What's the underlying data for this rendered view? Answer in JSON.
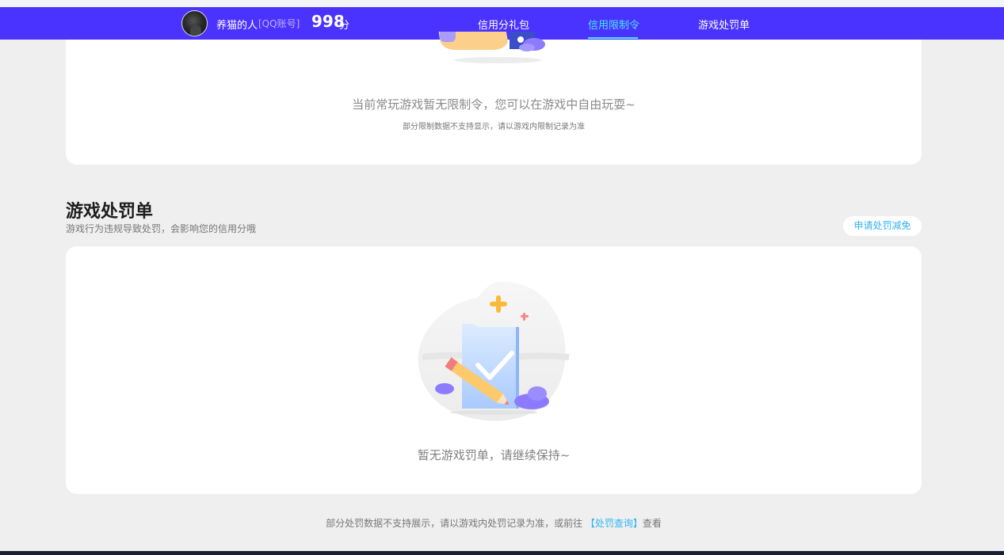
{
  "header": {
    "username": "养猫的人",
    "account_type": "[QQ账号]",
    "score": "998",
    "score_unit": "分",
    "nav": [
      {
        "label": "信用分礼包",
        "active": false
      },
      {
        "label": "信用限制令",
        "active": true
      },
      {
        "label": "游戏处罚单",
        "active": false
      }
    ],
    "accent_color": "#4b33ff",
    "active_color": "#46e6ff"
  },
  "restriction_card": {
    "empty_text": "当前常玩游戏暂无限制令，您可以在游戏中自由玩耍~",
    "note": "部分限制数据不支持显示，请以游戏内限制记录为准"
  },
  "penalty_section": {
    "title": "游戏处罚单",
    "subtitle": "游戏行为违规导致处罚，会影响您的信用分哦",
    "apply_button": "申请处罚减免",
    "empty_text": "暂无游戏罚单，请继续保持~"
  },
  "footer": {
    "note_prefix": "部分处罚数据不支持展示，请以游戏内处罚记录为准，或前往",
    "link_text": "【处罚查询】",
    "note_suffix": "查看"
  },
  "icons": [
    "avatar",
    "empty-restriction-illustration-icon",
    "empty-penalty-illustration-icon"
  ]
}
